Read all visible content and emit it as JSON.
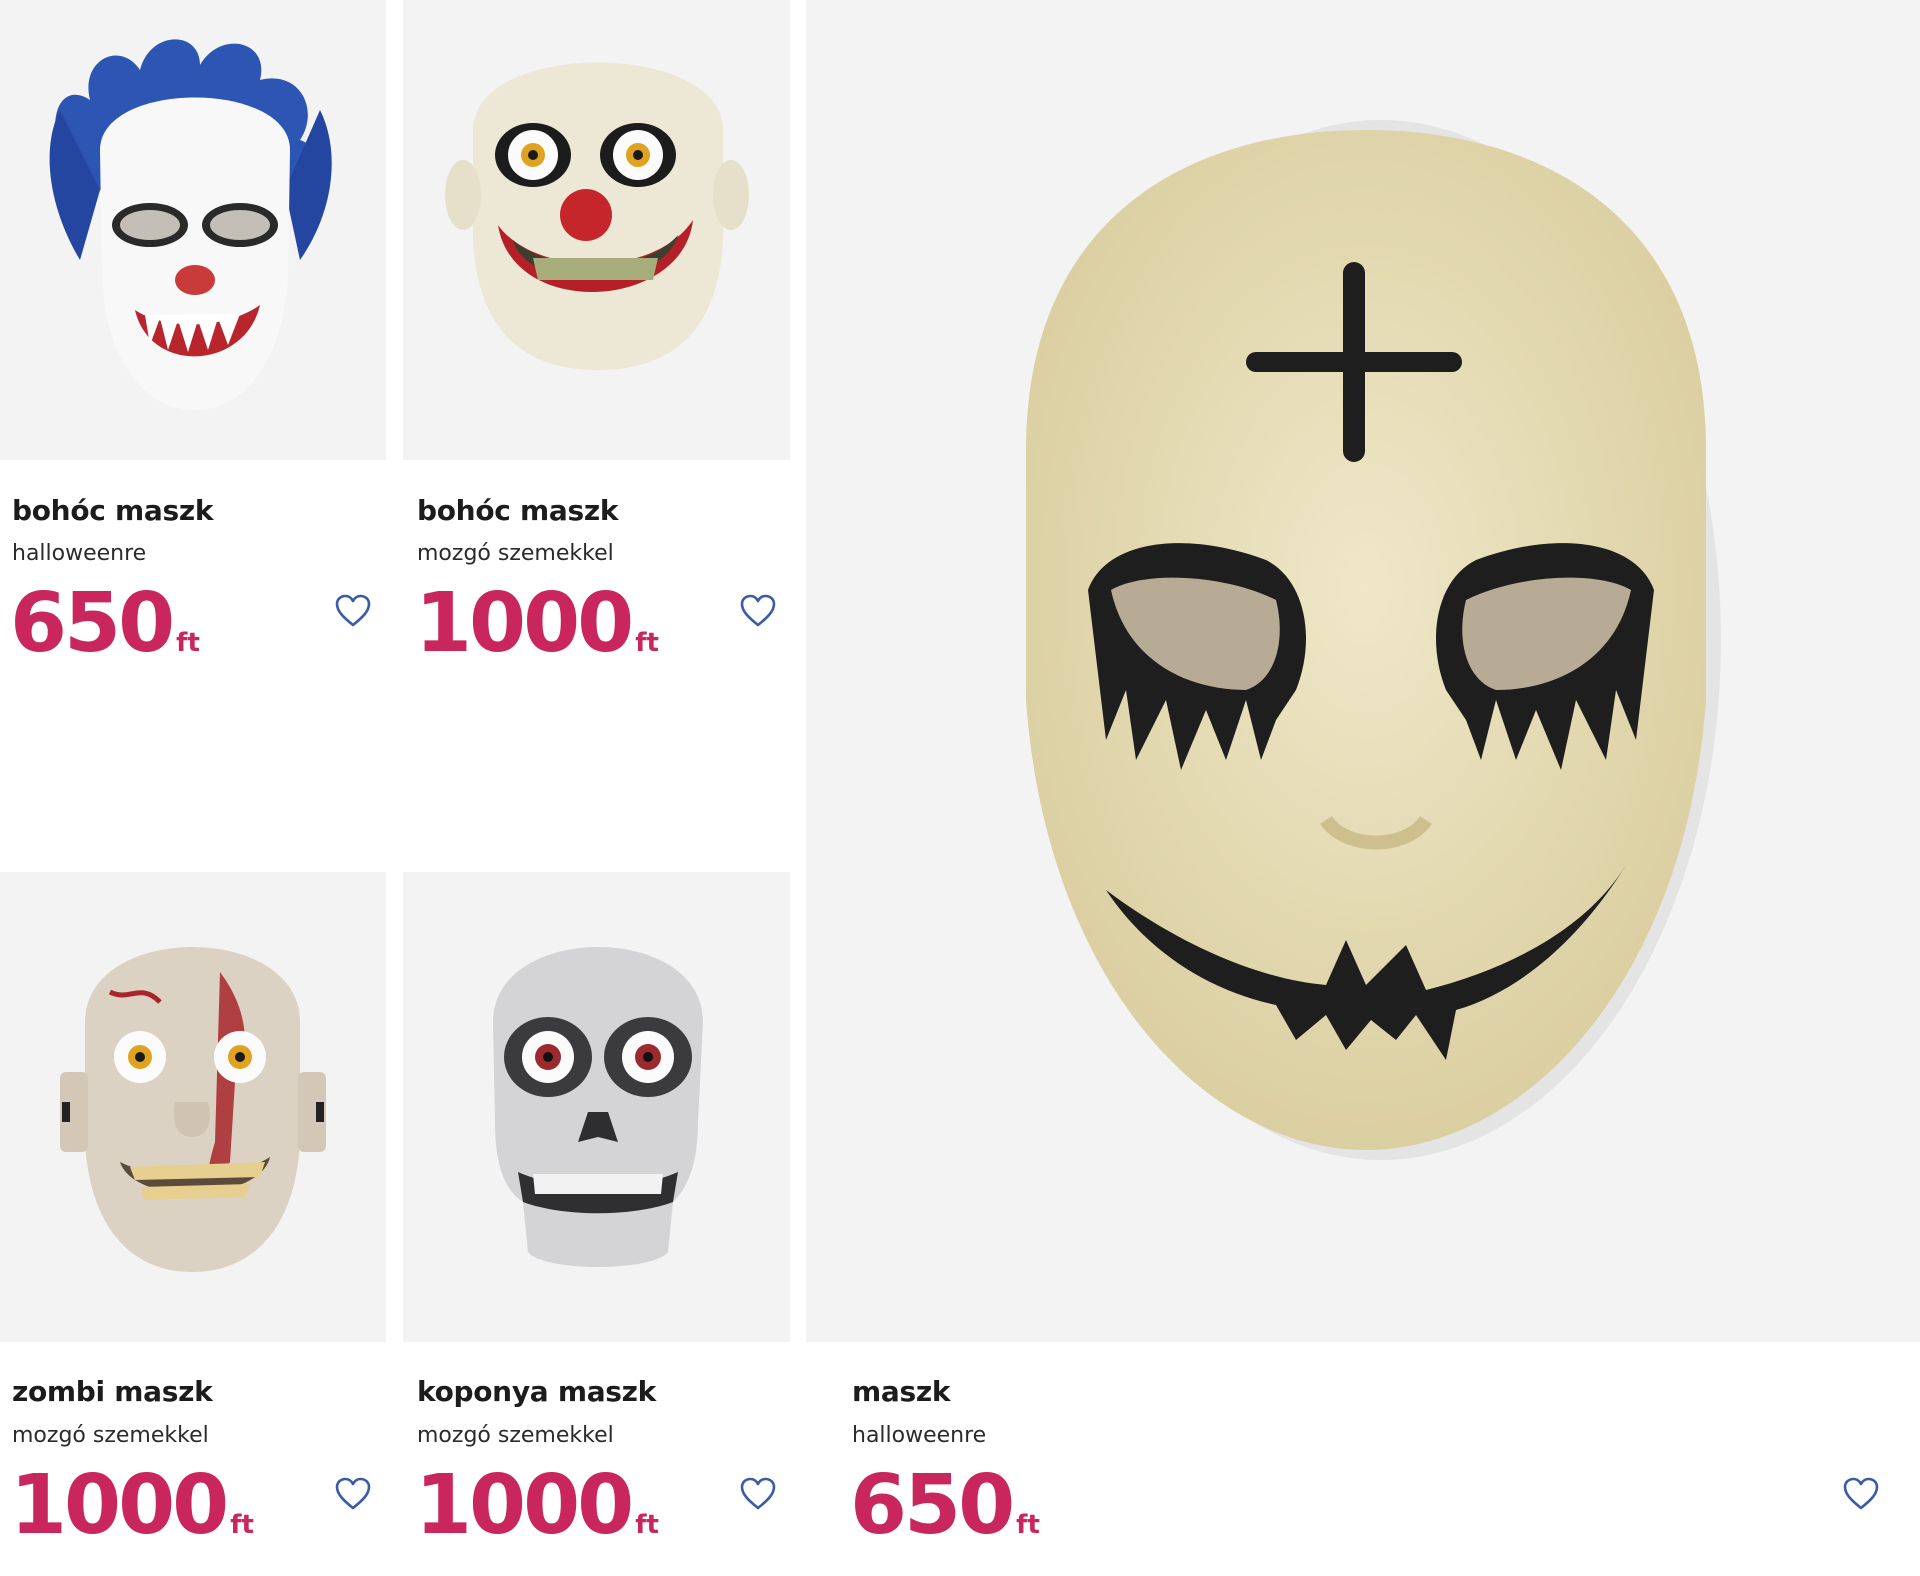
{
  "accent_color": "#c8265c",
  "heart_color": "#3a5ba8",
  "products": [
    {
      "title": "bohóc maszk",
      "subtitle": "halloweenre",
      "price": "650",
      "currency": "ft",
      "image_icon": "blue-hair-clown-mask-icon",
      "favorite_icon": "heart-outline-icon"
    },
    {
      "title": "bohóc maszk",
      "subtitle": "mozgó szemekkel",
      "price": "1000",
      "currency": "ft",
      "image_icon": "grinning-clown-mask-icon",
      "favorite_icon": "heart-outline-icon"
    },
    {
      "title": "zombi maszk",
      "subtitle": "mozgó szemekkel",
      "price": "1000",
      "currency": "ft",
      "image_icon": "zombie-mask-icon",
      "favorite_icon": "heart-outline-icon"
    },
    {
      "title": "koponya maszk",
      "subtitle": "mozgó szemekkel",
      "price": "1000",
      "currency": "ft",
      "image_icon": "skull-mask-icon",
      "favorite_icon": "heart-outline-icon"
    },
    {
      "title": "maszk",
      "subtitle": "halloweenre",
      "price": "650",
      "currency": "ft",
      "image_icon": "cross-face-mask-icon",
      "favorite_icon": "heart-outline-icon"
    }
  ]
}
